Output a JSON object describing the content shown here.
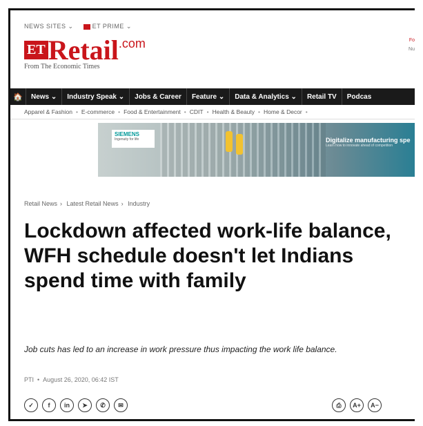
{
  "topbar": {
    "news_sites": "NEWS SITES ⌄",
    "et_prime": "ET PRIME ⌄"
  },
  "logo": {
    "et": "ET",
    "retail": "Retail",
    "com": ".com",
    "subtitle": "From The Economic Times"
  },
  "right_cut": {
    "line1": "Fo",
    "line2": "Nu"
  },
  "nav": {
    "home_icon": "home-icon",
    "items": [
      "News ⌄",
      "Industry Speak ⌄",
      "Jobs & Career",
      "Feature ⌄",
      "Data & Analytics ⌄",
      "Retail TV",
      "Podcas"
    ]
  },
  "subnav": {
    "items": [
      "Apparel & Fashion",
      "E-commerce",
      "Food & Entertainment",
      "CDIT",
      "Health & Beauty",
      "Home & Decor"
    ]
  },
  "banner": {
    "brand": "SIEMENS",
    "brand_sub": "Ingenuity for life",
    "tagline": "Digitalize manufacturing spe",
    "tagline_sub": "Learn how to innovate ahead of competition"
  },
  "breadcrumb": {
    "items": [
      "Retail News",
      "Latest Retail News",
      "Industry"
    ]
  },
  "article": {
    "headline": "Lockdown affected work-life balance, WFH schedule doesn't let Indians spend time with family",
    "synopsis": "Job cuts has led to an increase in work pressure thus impacting the work life balance.",
    "source": "PTI",
    "date": "August 26, 2020, 06:42 IST"
  },
  "share": {
    "icons": [
      "twitter-icon",
      "facebook-icon",
      "linkedin-icon",
      "telegram-icon",
      "whatsapp-icon",
      "email-icon"
    ],
    "glyphs": [
      "✓",
      "f",
      "in",
      "➤",
      "✆",
      "✉"
    ]
  },
  "tools": {
    "glyphs": [
      "⎙",
      "A+",
      "A−"
    ]
  },
  "colors": {
    "brand": "#c9151b",
    "nav_bg": "#1a1a1a"
  }
}
